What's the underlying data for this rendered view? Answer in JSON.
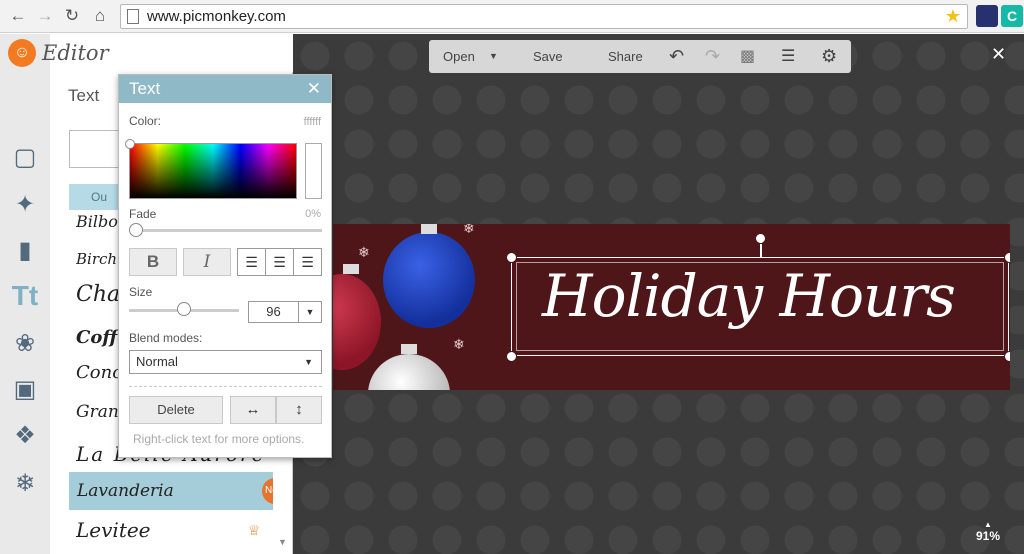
{
  "browser": {
    "url": "www.picmonkey.com",
    "back_icon": "arrow-left",
    "forward_icon": "arrow-right",
    "reload_icon": "reload",
    "home_icon": "home",
    "ext2_label": "C"
  },
  "app": {
    "logo_text": "Editor",
    "panel_title": "Text",
    "tab_label": "Ou",
    "fonts": [
      {
        "label": "Bilbo",
        "size": 16
      },
      {
        "label": "Birch",
        "size": 15
      },
      {
        "label": "Char",
        "size": 22
      },
      {
        "label": "Coffee",
        "size": 18
      },
      {
        "label": "Concert",
        "size": 18
      },
      {
        "label": "Grand",
        "size": 17
      },
      {
        "label": "La Belle Aurore",
        "size": 20
      },
      {
        "label": "Lavanderia",
        "size": 17
      },
      {
        "label": "Levitee",
        "size": 20
      }
    ],
    "new_badge": "New"
  },
  "toolbar": {
    "open": "Open",
    "save": "Save",
    "share": "Share"
  },
  "canvas": {
    "title": "Holiday Hours",
    "zoom": "91%"
  },
  "text_dialog": {
    "title": "Text",
    "color_label": "Color:",
    "color_value": "ffffff",
    "fade_label": "Fade",
    "fade_value": "0%",
    "bold_label": "B",
    "italic_label": "I",
    "size_label": "Size",
    "size_value": "96",
    "blend_label": "Blend modes:",
    "blend_value": "Normal",
    "delete_label": "Delete",
    "hint": "Right-click text for more options."
  },
  "colors": {
    "accent": "#8fb9c6",
    "banner": "#4e1618",
    "badge": "#e6732e"
  }
}
